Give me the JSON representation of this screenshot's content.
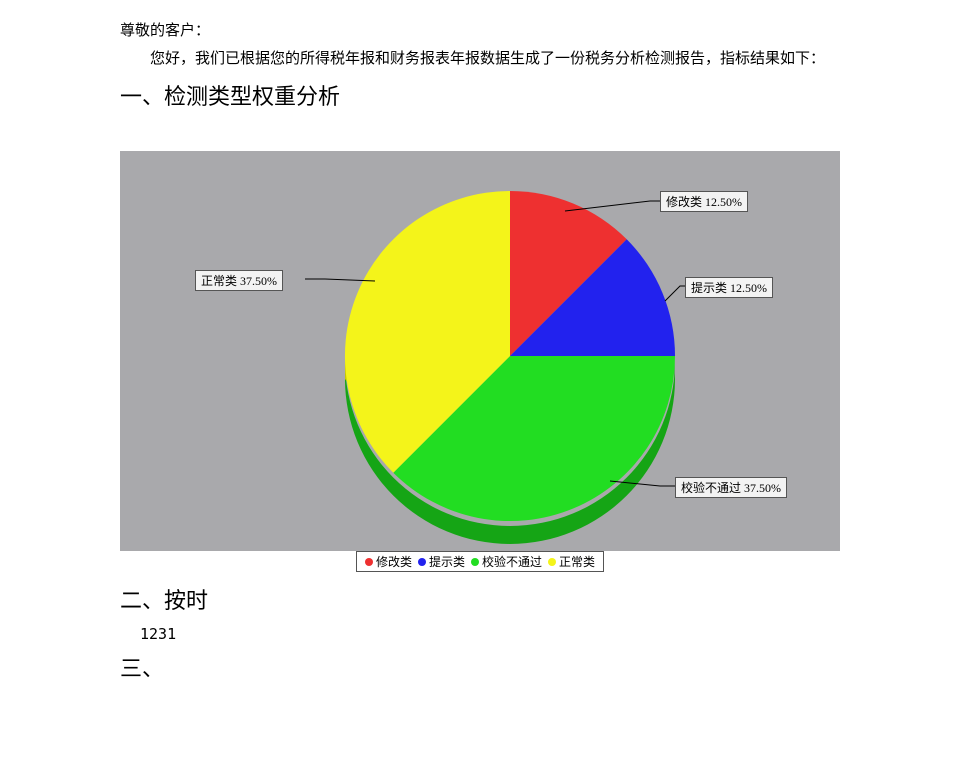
{
  "doc": {
    "greeting": "尊敬的客户：",
    "intro": "您好，我们已根据您的所得税年报和财务报表年报数据生成了一份税务分析检测报告，指标结果如下：",
    "section1_heading": "一、检测类型权重分析",
    "section2_heading": "二、按时",
    "section2_body": "1231",
    "section3_heading": "三、"
  },
  "chart_data": {
    "type": "pie",
    "title": "",
    "slices": [
      {
        "name": "修改类",
        "value": 12.5,
        "label": "修改类 12.50%",
        "color": "#ee3030"
      },
      {
        "name": "提示类",
        "value": 12.5,
        "label": "提示类 12.50%",
        "color": "#2222ee"
      },
      {
        "name": "校验不通过",
        "value": 37.5,
        "label": "校验不通过 37.50%",
        "color": "#22dd22"
      },
      {
        "name": "正常类",
        "value": 37.5,
        "label": "正常类 37.50%",
        "color": "#f4f41a"
      }
    ],
    "legend": [
      "修改类",
      "提示类",
      "校验不通过",
      "正常类"
    ]
  },
  "colors": {
    "chart_bg": "#a9a9ac",
    "callout_bg": "#f3f3f3"
  }
}
